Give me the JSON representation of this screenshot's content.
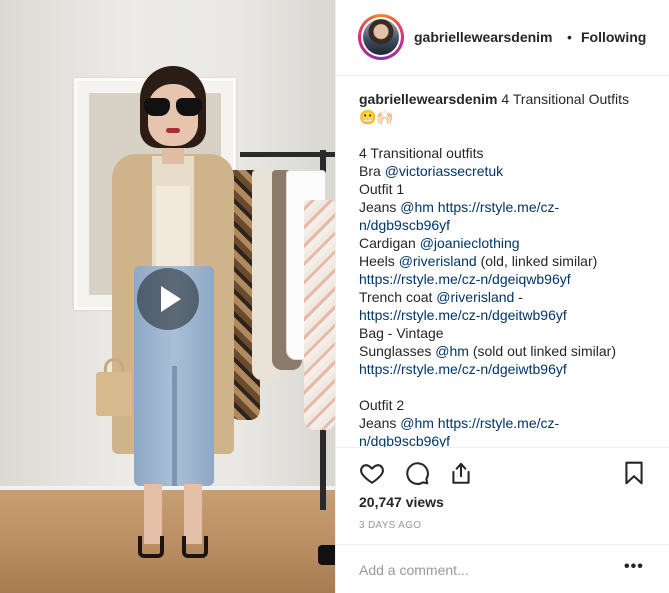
{
  "header": {
    "username": "gabriellewearsdenim",
    "separator": "•",
    "follow_status": "Following"
  },
  "caption": {
    "author": "gabriellewearsdenim",
    "title_text": " 4 Transitional Outfits",
    "emoji": "😬🙌🏻",
    "line_title": "4 Transitional outfits",
    "bra_label": "Bra ",
    "bra_handle": "@victoriassecretuk",
    "outfit1": "Outfit 1",
    "jeans_label": "Jeans ",
    "jeans_handle": "@hm",
    "jeans_link_a": " https://rstyle.me/cz-",
    "jeans_link_b": "n/dgb9scb96yf",
    "cardigan_label": "Cardigan ",
    "cardigan_handle": "@joanieclothing",
    "heels_label": "Heels ",
    "heels_handle": "@riverisland",
    "heels_note": " (old, linked similar)",
    "heels_link": "https://rstyle.me/cz-n/dgeiqwb96yf",
    "trench_label": "Trench coat ",
    "trench_handle": "@riverisland",
    "trench_dash": " -",
    "trench_link": "https://rstyle.me/cz-n/dgeitwb96yf",
    "bag_text": "Bag - Vintage",
    "sunglasses_label": "Sunglasses ",
    "sunglasses_handle": "@hm",
    "sunglasses_note": " (sold out linked similar)",
    "sunglasses_link": "https://rstyle.me/cz-n/dgeiwtb96yf",
    "outfit2": "Outfit 2",
    "jeans2_label": "Jeans ",
    "jeans2_handle": "@hm",
    "jeans2_link_a": " https://rstyle.me/cz-",
    "jeans2_link_b": "n/dgb9scb96yf"
  },
  "stats": {
    "views": "20,747 views",
    "date": "3 DAYS AGO"
  },
  "comment": {
    "placeholder": "Add a comment...",
    "more": "•••"
  },
  "icons": {
    "like": "heart-icon",
    "comment": "comment-icon",
    "share": "share-icon",
    "save": "bookmark-icon",
    "play": "play-icon"
  },
  "colors": {
    "link": "#003569",
    "text": "#262626",
    "muted": "#999999"
  }
}
